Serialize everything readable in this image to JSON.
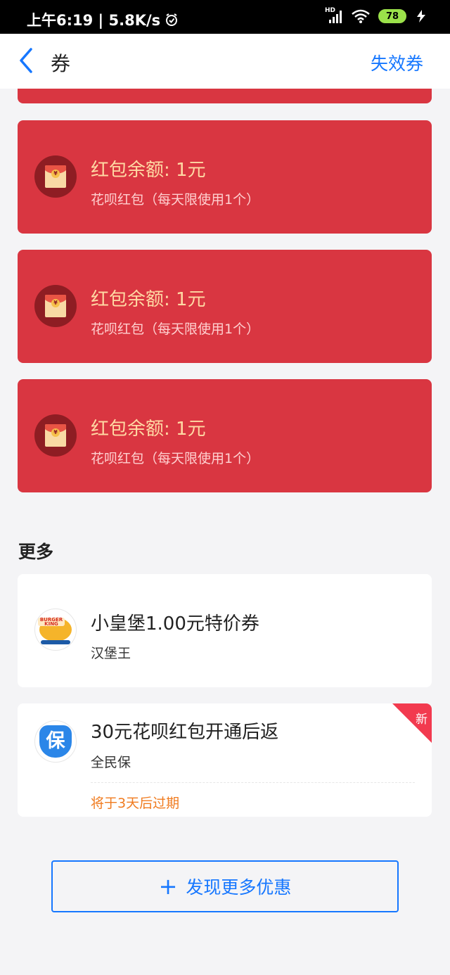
{
  "status_bar": {
    "time": "上午6:19 | 5.8K/s",
    "network": "HD",
    "battery": "78"
  },
  "nav": {
    "title": "券",
    "action": "失效券"
  },
  "red_packets": [
    {
      "title": "红包余额: 1元",
      "subtitle": "花呗红包（每天限使用1个）"
    },
    {
      "title": "红包余额: 1元",
      "subtitle": "花呗红包（每天限使用1个）"
    },
    {
      "title": "红包余额: 1元",
      "subtitle": "花呗红包（每天限使用1个）"
    }
  ],
  "more": {
    "section_title": "更多",
    "items": [
      {
        "title": "小皇堡1.00元特价券",
        "merchant": "汉堡王",
        "logo_text": "BURGER KING"
      },
      {
        "title": "30元花呗红包开通后返",
        "merchant": "全民保",
        "logo_text": "保",
        "expiry": "将于3天后过期",
        "badge": "新"
      }
    ]
  },
  "discover_button": {
    "icon": "+",
    "label": "发现更多优惠"
  },
  "colors": {
    "accent": "#1677ff",
    "red_card": "#d93641",
    "expiry": "#f07b1f"
  }
}
